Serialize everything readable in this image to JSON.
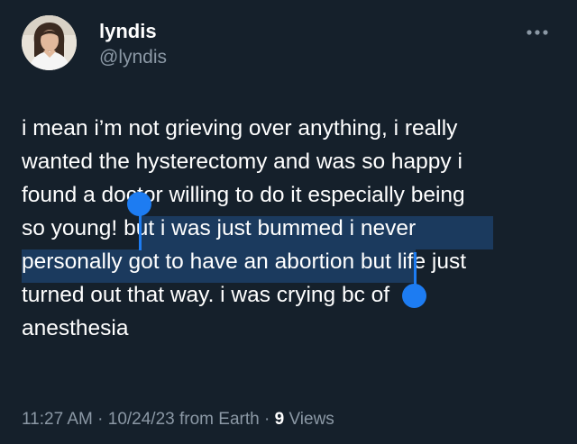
{
  "author": {
    "name": "lyndis",
    "handle": "@lyndis"
  },
  "more_icon": "ellipsis-icon",
  "tweet": {
    "lines": [
      "i mean i’m not grieving over anything, i really",
      "wanted the hysterectomy and was so happy i",
      "found a doctor willing to do it especially being",
      "so young! ",
      "but i was just bummed i never",
      "personally got to have an abortion",
      " but life just",
      "turned out that way. i was crying bc of",
      "anesthesia"
    ],
    "selected_text": "but i was just bummed i never personally got to have an abortion"
  },
  "meta": {
    "time": "11:27 AM",
    "sep1": " · ",
    "date": "10/24/23",
    "source": " from Earth",
    "sep2": " · ",
    "views_count": "9",
    "views_label": " Views"
  },
  "colors": {
    "background": "#15202b",
    "text": "#ffffff",
    "secondary": "#8b98a5",
    "selection": "#1b3a5e",
    "handle": "#1d7cf2"
  }
}
